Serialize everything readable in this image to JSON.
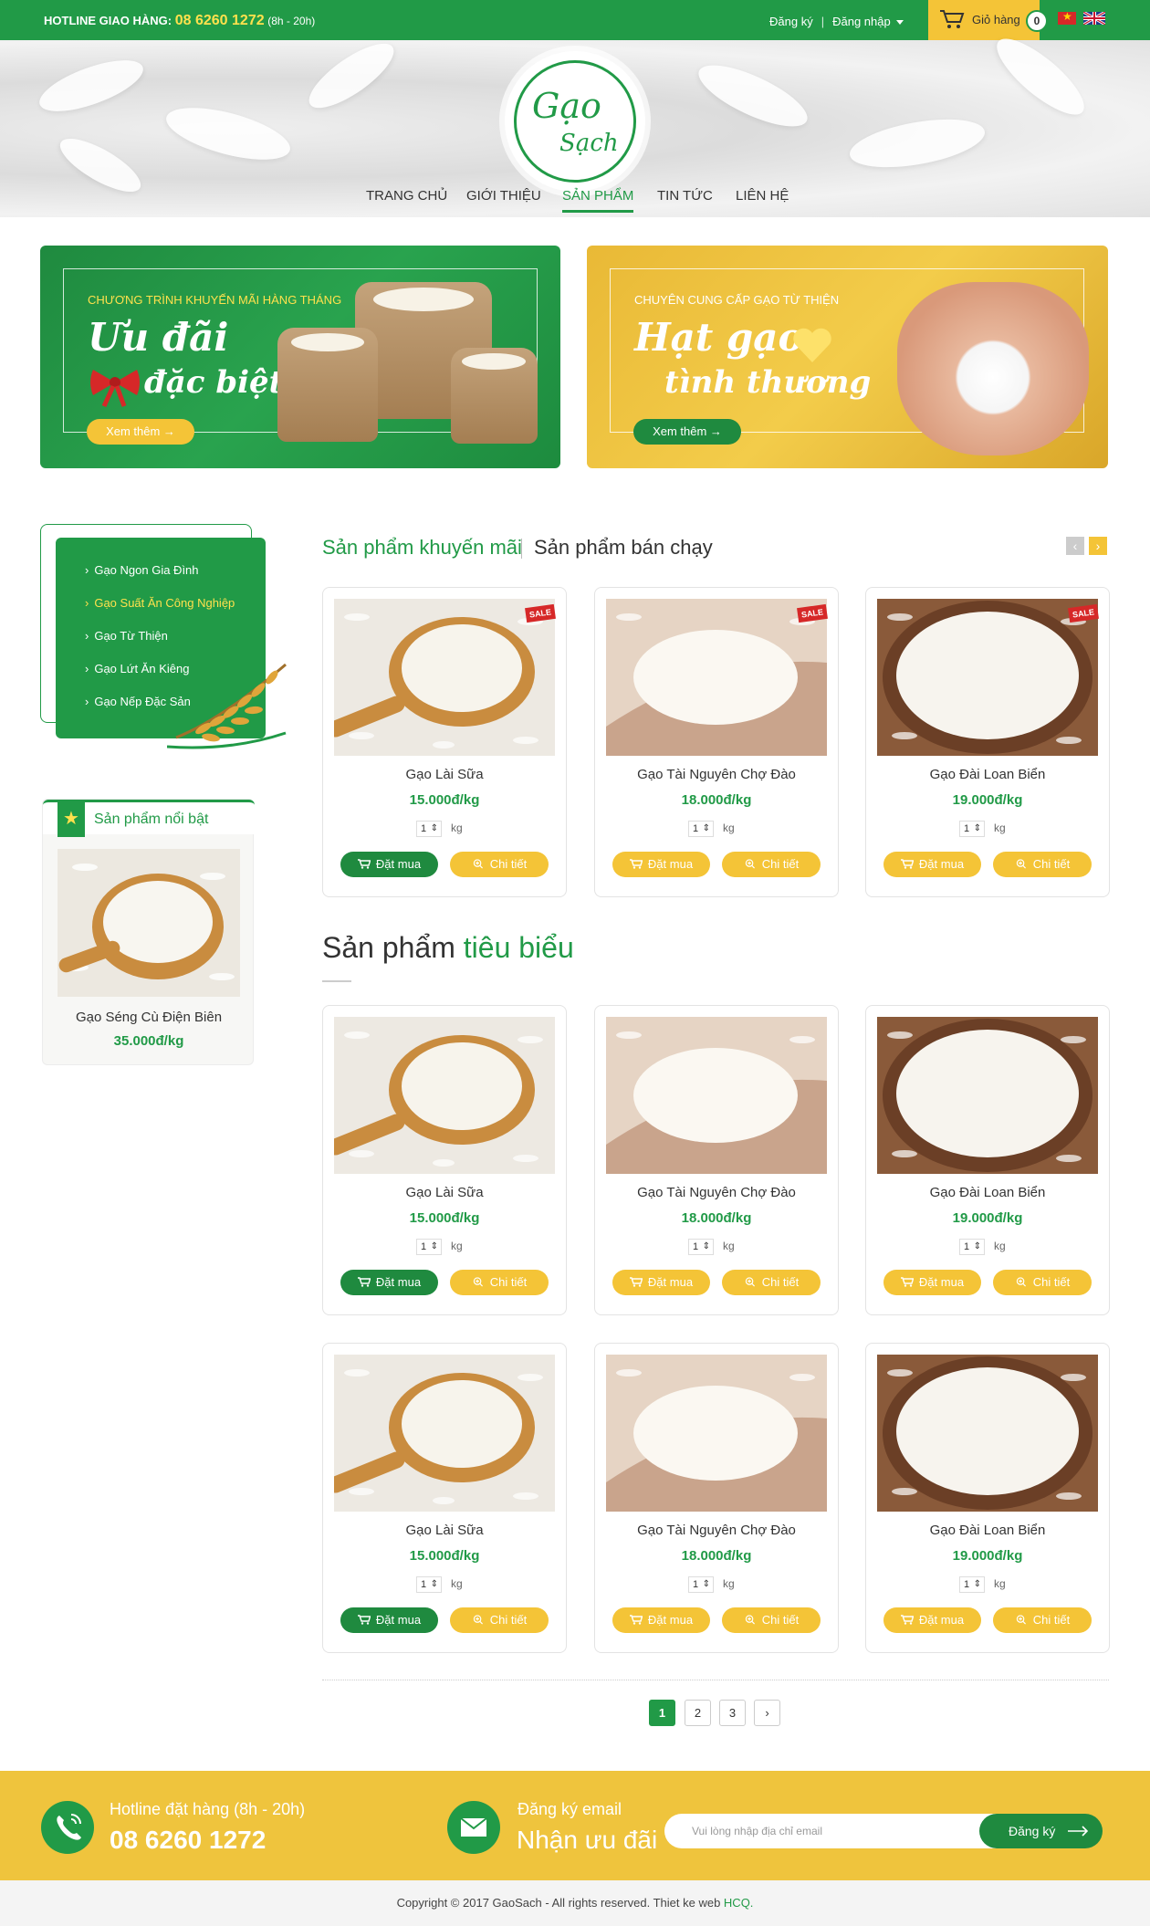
{
  "topbar": {
    "hotline_label": "HOTLINE GIAO HÀNG:",
    "hotline_number": "08 6260 1272",
    "hotline_hours": "(8h - 20h)",
    "register": "Đăng ký",
    "separator": "|",
    "login": "Đăng nhập",
    "cart_label": "Giỏ hàng",
    "cart_count": "0"
  },
  "logo": {
    "line1": "Gạo",
    "line2": "Sạch"
  },
  "nav": [
    "TRANG CHỦ",
    "GIỚI THIỆU",
    "SẢN PHẨM",
    "TIN TỨC",
    "LIÊN HỆ"
  ],
  "nav_active": "SẢN PHẨM",
  "banners": [
    {
      "subtitle": "CHƯƠNG TRÌNH KHUYẾN MÃI HÀNG THÁNG",
      "title1": "Ưu đãi",
      "title2": "đặc biệt",
      "button": "Xem thêm →"
    },
    {
      "subtitle": "CHUYÊN CUNG CẤP GẠO TỪ THIỆN",
      "title1": "Hạt gạo",
      "title2": "tình thương",
      "button": "Xem thêm →"
    }
  ],
  "categories": [
    "Gạo Ngon Gia Đình",
    "Gạo Suất Ăn Công Nghiệp",
    "Gạo Từ Thiện",
    "Gạo Lứt Ăn Kiêng",
    "Gạo Nếp Đặc Sản"
  ],
  "featured_sidebar": {
    "title": "Sản phẩm nổi bật",
    "name": "Gạo Séng Cù Điện Biên",
    "price": "35.000đ/kg"
  },
  "tabs": {
    "promo": "Sản phẩm khuyến mãi",
    "bestseller": "Sản phẩm bán chạy"
  },
  "sale_badge": "SALE",
  "section_title": {
    "normal": "Sản phẩm",
    "highlight": "tiêu biểu"
  },
  "products": [
    {
      "name": "Gạo Lài Sữa",
      "price": "15.000đ/kg"
    },
    {
      "name": "Gạo Tài Nguyên Chợ Đào",
      "price": "18.000đ/kg"
    },
    {
      "name": "Gạo Đài Loan Biển",
      "price": "19.000đ/kg"
    }
  ],
  "qty_default": "1",
  "unit": "kg",
  "buy_label": "Đặt mua",
  "detail_label": "Chi tiết",
  "pagination": [
    "1",
    "2",
    "3",
    "›"
  ],
  "footer": {
    "hotline_label": "Hotline đặt hàng (8h - 20h)",
    "hotline_number": "08 6260 1272",
    "email_label": "Đăng ký email",
    "email_big": "Nhận ưu đãi",
    "email_placeholder": "Vui lòng nhập địa chỉ email",
    "email_button": "Đăng ký",
    "copyright": "Copyright © 2017 GaoSach - All rights reserved. Thiet ke web ",
    "copyright_link": "HCQ."
  },
  "colors": {
    "green": "#219a47",
    "yellow": "#f4c437",
    "dark_green": "#1f8a3f"
  }
}
